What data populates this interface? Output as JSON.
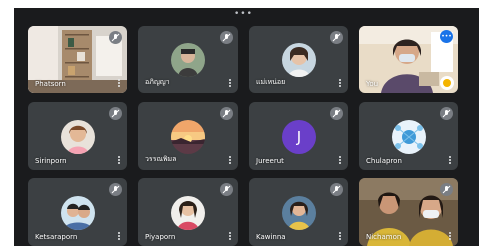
{
  "window": {
    "dots": "•••"
  },
  "participants": [
    {
      "name": "Phatsorn",
      "tile_kind": "video-shelves"
    },
    {
      "name": "อภิญญา",
      "tile_kind": "avatar"
    },
    {
      "name": "แม่เหน่อย",
      "tile_kind": "avatar"
    },
    {
      "name": "You",
      "tile_kind": "video-self"
    },
    {
      "name": "Sirinporn",
      "tile_kind": "avatar"
    },
    {
      "name": "วรรณพิมล",
      "tile_kind": "avatar-sunset"
    },
    {
      "name": "Jureerut",
      "tile_kind": "letter",
      "initial": "J"
    },
    {
      "name": "Chulapron",
      "tile_kind": "avatar-globe"
    },
    {
      "name": "Ketsaraporn",
      "tile_kind": "avatar"
    },
    {
      "name": "Piyaporn",
      "tile_kind": "avatar"
    },
    {
      "name": "Kawinna",
      "tile_kind": "avatar"
    },
    {
      "name": "Nichamon",
      "tile_kind": "video-two-people"
    }
  ],
  "colors": {
    "background": "#1a1b1d",
    "tile": "#3c4043",
    "letter_avatar": "#6a3fc9",
    "mute_badge": "#7a7e84",
    "self_badge": "#1a73e8"
  },
  "icons": {
    "mute": "mic-off-icon",
    "more": "more-vertical-icon",
    "self_indicator": "audio-level-icon",
    "reaction": "emoji-reaction-icon"
  }
}
